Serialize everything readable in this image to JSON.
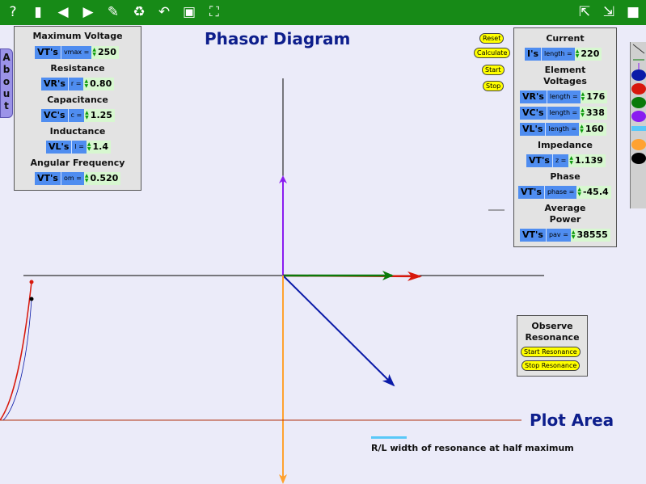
{
  "app": {
    "title": "Phasor Diagram",
    "plot_area_label": "Plot Area"
  },
  "toolbar": {
    "left": [
      {
        "name": "help-icon",
        "glyph": "?"
      },
      {
        "name": "new-page-icon",
        "glyph": "▮"
      },
      {
        "name": "previous-icon",
        "glyph": "◀"
      },
      {
        "name": "next-icon",
        "glyph": "▶"
      },
      {
        "name": "eraser-icon",
        "glyph": "✎"
      },
      {
        "name": "recycle-icon",
        "glyph": "♻"
      },
      {
        "name": "undo-icon",
        "glyph": "↶"
      },
      {
        "name": "screenshot-icon",
        "glyph": "▣"
      },
      {
        "name": "fullscreen-icon",
        "glyph": "⛶"
      }
    ],
    "right": [
      {
        "name": "share-icon",
        "glyph": "⇱"
      },
      {
        "name": "export-icon",
        "glyph": "⇲"
      },
      {
        "name": "stop-icon",
        "glyph": "■"
      }
    ]
  },
  "about": {
    "label": "About",
    "letters": [
      "A",
      "b",
      "o",
      "u",
      "t"
    ]
  },
  "inputs": {
    "vmax": {
      "heading": "Maximum Voltage",
      "label": "VT's",
      "sub": "vmax =",
      "value": "250"
    },
    "r": {
      "heading": "Resistance",
      "label": "VR's",
      "sub": "r =",
      "value": "0.80"
    },
    "c": {
      "heading": "Capacitance",
      "label": "VC's",
      "sub": "c =",
      "value": "1.25"
    },
    "l": {
      "heading": "Inductance",
      "label": "VL's",
      "sub": "l =",
      "value": "1.4"
    },
    "om": {
      "heading": "Angular Frequency",
      "label": "VT's",
      "sub": "om =",
      "value": "0.520"
    }
  },
  "controls": {
    "reset": "Reset",
    "calculate": "Calculate",
    "start": "Start",
    "stop": "Stop"
  },
  "outputs": {
    "current_heading": "Current",
    "current": {
      "label": "I's",
      "sub": "length =",
      "value": "220"
    },
    "element_heading_1": "Element",
    "element_heading_2": "Voltages",
    "vr": {
      "label": "VR's",
      "sub": "length =",
      "value": "176"
    },
    "vc": {
      "label": "VC's",
      "sub": "length =",
      "value": "338"
    },
    "vl": {
      "label": "VL's",
      "sub": "length =",
      "value": "160"
    },
    "impedance_heading": "Impedance",
    "impedance": {
      "label": "VT's",
      "sub": "z =",
      "value": "1.139"
    },
    "phase_heading": "Phase",
    "phase": {
      "label": "VT's",
      "sub": "phase =",
      "value": "-45.4"
    },
    "power_heading_1": "Average",
    "power_heading_2": "Power",
    "power": {
      "label": "VT's",
      "sub": "pav =",
      "value": "38555"
    }
  },
  "resonance": {
    "heading_1": "Observe",
    "heading_2": "Resonance",
    "start": "Start Resonance",
    "stop": "Stop Resonance"
  },
  "legend": {
    "text": "R/L width of resonance at half maximum",
    "color": "#59c8f8"
  },
  "colors": {
    "toolbar": "#178a17",
    "vl_phasor": "#8a1cf0",
    "vr_phasor": "#0a7a0a",
    "vtot_phasor": "#d8180c",
    "vt_phasor": "#0a1aa8",
    "vc_phasor": "#ffa230",
    "resonance_curve": "#d8180c",
    "title": "#0d1e8c"
  },
  "palette": [
    "#0a1aa8",
    "#d8180c",
    "#0a7a0a",
    "#8a1cf0",
    "#59c8f8",
    "#ffa230",
    "#000000"
  ]
}
